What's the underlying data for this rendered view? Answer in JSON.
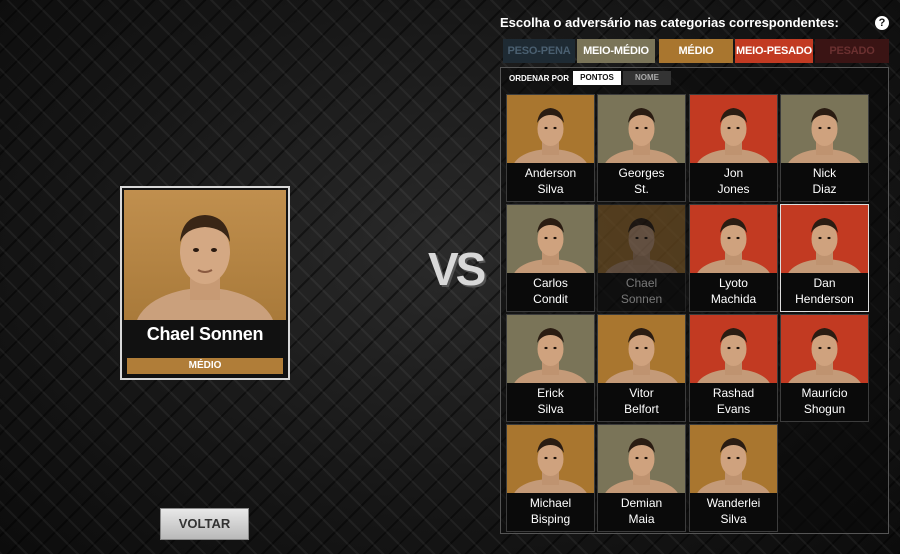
{
  "selected": {
    "name": "Chael Sonnen",
    "category": "MÉDIO",
    "photo_bg": "#b07d38"
  },
  "vs_text": "VS",
  "back_button": "VOLTAR",
  "prompt": "Escolha o adversário nas categorias correspondentes:",
  "help_icon": "?",
  "categories": [
    {
      "label": "PESO-PENA",
      "bg": "#1e2a33",
      "color": "#4a5f70"
    },
    {
      "label": "MEIO-MÉDIO",
      "bg": "#7a7458",
      "color": "#ffffff"
    },
    {
      "label": "MÉDIO",
      "bg": "#a9762f",
      "color": "#ffffff"
    },
    {
      "label": "MEIO-PESADO",
      "bg": "#c23a22",
      "color": "#ffffff"
    },
    {
      "label": "PESADO",
      "bg": "#3a1414",
      "color": "#6a3030"
    }
  ],
  "sort": {
    "label": "ORDENAR POR",
    "options": [
      "PONTOS",
      "NOME"
    ],
    "active": "PONTOS"
  },
  "fighters": [
    {
      "first": "Anderson",
      "last": "Silva",
      "bg": "#a9762f"
    },
    {
      "first": "Georges",
      "last": "St.",
      "bg": "#7a7458"
    },
    {
      "first": "Jon",
      "last": "Jones",
      "bg": "#c23a22"
    },
    {
      "first": "Nick",
      "last": "Diaz",
      "bg": "#7a7458"
    },
    {
      "first": "Carlos",
      "last": "Condit",
      "bg": "#7a7458"
    },
    {
      "first": "Chael",
      "last": "Sonnen",
      "bg": "#a9762f"
    },
    {
      "first": "Lyoto",
      "last": "Machida",
      "bg": "#c23a22"
    },
    {
      "first": "Dan",
      "last": "Henderson",
      "bg": "#c23a22"
    },
    {
      "first": "Erick",
      "last": "Silva",
      "bg": "#7a7458"
    },
    {
      "first": "Vitor",
      "last": "Belfort",
      "bg": "#a9762f"
    },
    {
      "first": "Rashad",
      "last": "Evans",
      "bg": "#c23a22"
    },
    {
      "first": "Maurício",
      "last": "Shogun",
      "bg": "#c23a22"
    },
    {
      "first": "Michael",
      "last": "Bisping",
      "bg": "#a9762f"
    },
    {
      "first": "Demian",
      "last": "Maia",
      "bg": "#7a7458"
    },
    {
      "first": "Wanderlei",
      "last": "Silva",
      "bg": "#a9762f"
    }
  ],
  "dimmed_fighter": "Chael Sonnen",
  "highlighted_fighter": "Dan Henderson"
}
